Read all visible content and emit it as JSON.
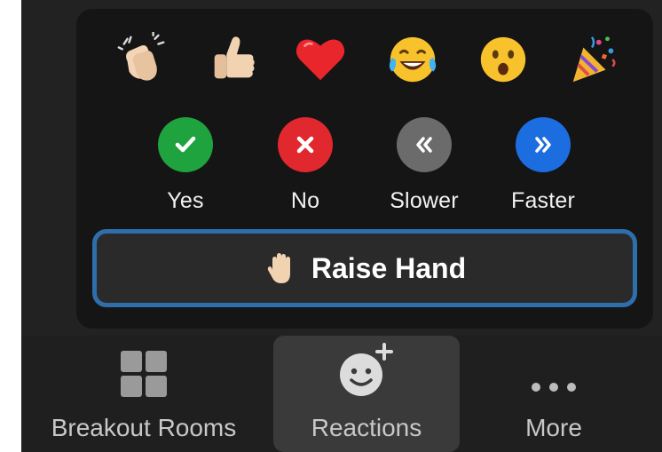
{
  "reactions": {
    "emojis": [
      {
        "name": "clapping-hands"
      },
      {
        "name": "thumbs-up"
      },
      {
        "name": "red-heart"
      },
      {
        "name": "tears-of-joy"
      },
      {
        "name": "face-open-mouth"
      },
      {
        "name": "party-popper"
      }
    ],
    "status_buttons": [
      {
        "label": "Yes",
        "color": "#1fa33f",
        "icon": "check-icon"
      },
      {
        "label": "No",
        "color": "#e0282e",
        "icon": "x-icon"
      },
      {
        "label": "Slower",
        "color": "#6b6b6b",
        "icon": "double-chevron-left-icon"
      },
      {
        "label": "Faster",
        "color": "#1c6de0",
        "icon": "double-chevron-right-icon"
      }
    ],
    "raise_hand_label": "Raise Hand"
  },
  "toolbar": {
    "breakout_rooms_label": "Breakout Rooms",
    "reactions_label": "Reactions",
    "more_label": "More"
  },
  "colors": {
    "popup_bg": "#151515",
    "raise_hand_border": "#2e6ead",
    "toolbar_bg": "#1f1f1f",
    "active_tab_bg": "#3a3a3a"
  }
}
